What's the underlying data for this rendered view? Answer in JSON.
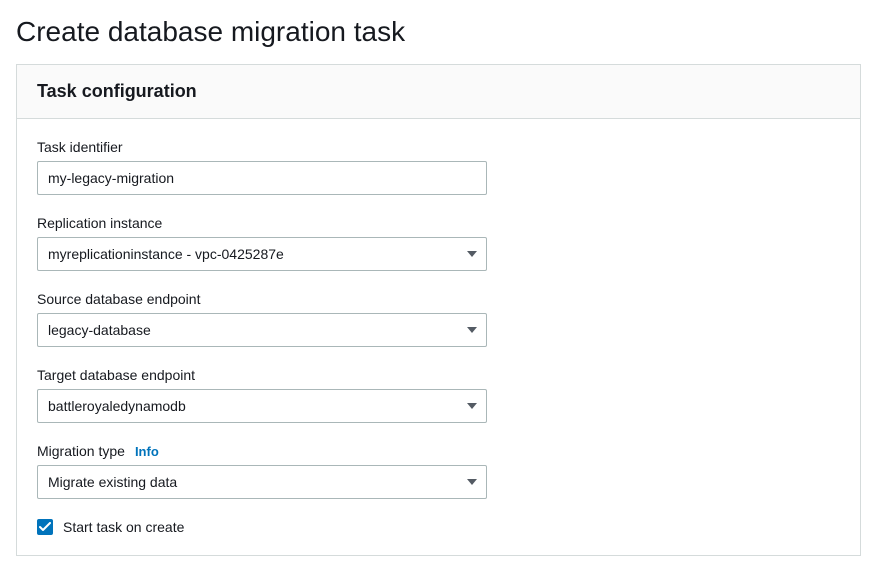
{
  "page": {
    "title": "Create database migration task"
  },
  "panel": {
    "title": "Task configuration"
  },
  "form": {
    "taskIdentifier": {
      "label": "Task identifier",
      "value": "my-legacy-migration"
    },
    "replicationInstance": {
      "label": "Replication instance",
      "value": "myreplicationinstance - vpc-0425287e"
    },
    "sourceEndpoint": {
      "label": "Source database endpoint",
      "value": "legacy-database"
    },
    "targetEndpoint": {
      "label": "Target database endpoint",
      "value": "battleroyaledynamodb"
    },
    "migrationType": {
      "label": "Migration type",
      "info": "Info",
      "value": "Migrate existing data"
    },
    "startOnCreate": {
      "label": "Start task on create",
      "checked": true
    }
  }
}
